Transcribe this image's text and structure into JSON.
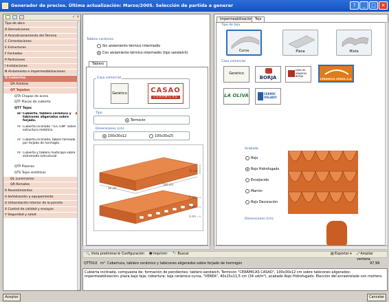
{
  "window": {
    "title": "Generador de precios. Última actualización: Marzo/2005. Selección de partida a generar",
    "min_icon": "minimize-icon",
    "max_icon": "maximize-icon",
    "close_icon": "close-icon",
    "help_label": "?"
  },
  "left_tree": {
    "items": [
      {
        "label": "Tipo de obra",
        "kind": "cat"
      },
      {
        "label": "D  Demoliciones",
        "kind": "cat"
      },
      {
        "label": "A  Acondicionamiento del Terreno",
        "kind": "cat"
      },
      {
        "label": "C  Cimentaciones",
        "kind": "cat"
      },
      {
        "label": "E  Estructuras",
        "kind": "cat"
      },
      {
        "label": "F  Fachadas",
        "kind": "cat"
      },
      {
        "label": "P  Particiones",
        "kind": "cat"
      },
      {
        "label": "I  Instalaciones",
        "kind": "cat"
      },
      {
        "label": "N  Aislamiento e impermeabilizaciones",
        "kind": "cat"
      },
      {
        "label": "Q  Cubiertas",
        "kind": "catsel"
      },
      {
        "label": "QA  Azoteas",
        "kind": "sub1"
      },
      {
        "label": "QT  Tejados",
        "kind": "sub1sel"
      },
      {
        "label": "QTA  Chapas de acero",
        "kind": "sub2"
      },
      {
        "label": "QTF  Placas de cubierta",
        "kind": "sub2"
      },
      {
        "label": "QTT  Tejas",
        "kind": "sub2sel"
      }
    ],
    "tejas_items": [
      {
        "code": "m²",
        "label": "Cubierta, tablero cerámico y tabicones aligerados sobre forjado.",
        "selected": true
      },
      {
        "code": "m²",
        "label": "Cubierta inclinada \"TECTUM\" sobre estructura metálica.",
        "selected": false
      },
      {
        "code": "m²",
        "label": "Cubierta inclinada, tablón formado por forjado de hormigón.",
        "selected": false
      },
      {
        "code": "m²",
        "label": "Cubierta y tablero multicapa sobre entramado estructural.",
        "selected": false
      }
    ],
    "after_items": [
      {
        "label": "QTP  Pizarras",
        "kind": "sub2"
      },
      {
        "label": "QTS  Tejas sintéticas",
        "kind": "sub2"
      },
      {
        "label": "QL  Lucernarios",
        "kind": "sub1"
      },
      {
        "label": "QR  Remates",
        "kind": "sub1"
      },
      {
        "label": "R  Revestimientos",
        "kind": "cat"
      },
      {
        "label": "S  Señalización y equipamiento",
        "kind": "cat"
      },
      {
        "label": "U  Urbanización interior de la parcela",
        "kind": "cat"
      },
      {
        "label": "X  Control de calidad y ensayos",
        "kind": "cat"
      },
      {
        "label": "Y  Seguridad y salud",
        "kind": "cat"
      }
    ]
  },
  "middle": {
    "group_title": "Tablero cerámico",
    "radio_options": [
      {
        "label": "Sin aislamiento térmico intermedio",
        "selected": false
      },
      {
        "label": "Con aislamiento térmico intermedio (tipo sandwich)",
        "selected": true
      }
    ],
    "tab_label": "Tablero",
    "casa_comercial_label": "Casa comercial",
    "generico_label": "Genérico",
    "casao_logo": "CASAO",
    "casao_sub": "CERÁMICAS",
    "tipo_label": "Tipo",
    "tipo_value": "Termicón",
    "dimensiones_label": "Dimensiones (cm)",
    "dim_options": [
      {
        "label": "100x30x12",
        "selected": true
      },
      {
        "label": "100x30x25",
        "selected": false
      }
    ],
    "dims_drawing": [
      "12 cm",
      "4 cm",
      "4 cm",
      "3 cm",
      "30 cm",
      "100 cm"
    ]
  },
  "right": {
    "tabs": [
      "Impermeabilización",
      "Teja"
    ],
    "tipo_teja_label": "Tipo de teja",
    "tejas": [
      {
        "label": "Curva",
        "selected": true
      },
      {
        "label": "Plana",
        "selected": false
      },
      {
        "label": "Mixta",
        "selected": false
      }
    ],
    "casa_comercial_label": "Casa comercial",
    "brands": [
      "Genérico",
      "BORJA",
      "Hijos de ARAMÓN BORJA",
      "CERÁMICA VEREA S.A.",
      "LA OLIVA",
      "CERMIC OSLADO"
    ],
    "acabado_label": "Acabado",
    "acabados": [
      {
        "label": "Rojo",
        "selected": false
      },
      {
        "label": "Rojo Hidrofugado",
        "selected": true
      },
      {
        "label": "Envejecido",
        "selected": false
      },
      {
        "label": "Marrón",
        "selected": false
      },
      {
        "label": "Rojo Decoración",
        "selected": false
      }
    ],
    "dimensiones_label": "Dimensiones (cm)"
  },
  "toolbar": {
    "vista_label": "Vista preliminar",
    "config_label": "Configuración",
    "imprimir_label": "Imprimir",
    "buscar_label": "Buscar",
    "exportar_label": "Exportar",
    "ampliar_label": "Ampliar ventana"
  },
  "result": {
    "code": "QTT010",
    "unit": "m²",
    "title": "Cobertura, tablero cerámico y tabicones aligerados sobre forjado de hormigón",
    "price": "97,99",
    "description": "Cubierta inclinada, compuesta de: formación de pendientes: tablero sandwich, Termicón \"CERÁMICAS CASAO\", 100x30x12 cm sobre tabicones aligerados; impermeabilización: placa bajo teja; cobertura: teja cerámica curva, \"VEREA\", 40x15x11,5 cm (34 ud/m²), acabado Rojo Hidrofugado. Elección del enrastrelado con mortero."
  },
  "footer": {
    "accept_label": "Aceptar",
    "cancel_label": "Cancelar"
  },
  "colors": {
    "title_blue": "#1651c4",
    "category_pink": "#f2d9cc",
    "selected_red": "#d97a6a",
    "brick_orange": "#d4692c"
  }
}
